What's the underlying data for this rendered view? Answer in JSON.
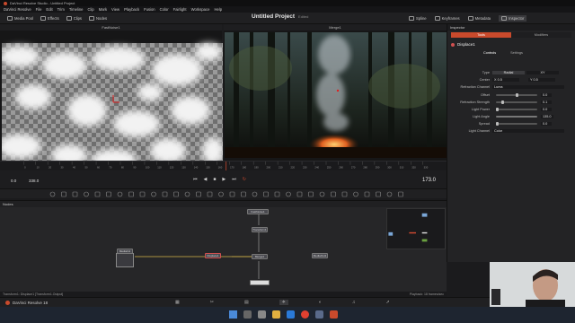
{
  "window": {
    "title": "DaVinci Resolve Studio - Untitled Project"
  },
  "menu": [
    "DaVinci Resolve",
    "File",
    "Edit",
    "Trim",
    "Timeline",
    "Clip",
    "Mark",
    "View",
    "Playback",
    "Fusion",
    "Color",
    "Fairlight",
    "Workspace",
    "Help"
  ],
  "toolbar": {
    "left": [
      "Media Pool",
      "Effects",
      "Clips",
      "Nodes"
    ],
    "project": "Untitled Project",
    "edited": "Edited",
    "right": [
      "Spline",
      "Keyframes",
      "Metadata",
      "Inspector"
    ]
  },
  "viewers": {
    "left_title": "FastNoise1",
    "right_title": "Merge1"
  },
  "ruler": [
    "0",
    "10",
    "20",
    "30",
    "40",
    "50",
    "60",
    "70",
    "80",
    "90",
    "100",
    "110",
    "120",
    "130",
    "140",
    "150",
    "160",
    "170",
    "180",
    "190",
    "200",
    "210",
    "220",
    "230",
    "240",
    "250",
    "260",
    "270",
    "280",
    "290",
    "300",
    "310",
    "320",
    "330"
  ],
  "transport": {
    "start": "0.0",
    "end": "338.0",
    "current": "173.0"
  },
  "nodes": {
    "panel_label": "Nodes",
    "items": [
      {
        "label": "MediaIn1",
        "color": "#6a6a70"
      },
      {
        "label": "Displace1",
        "color": "#7a5a5a"
      },
      {
        "label": "Merge1",
        "color": "#5a5a66"
      },
      {
        "label": "Transform1",
        "color": "#6a6a55"
      },
      {
        "label": "FastNoise1",
        "color": "#555a66"
      },
      {
        "label": "MediaOut1",
        "color": "#5a5a60"
      }
    ]
  },
  "status": {
    "left": "Transform1: Displace1 [Transform1.Output]",
    "right": "Playback: 18 frames/sec"
  },
  "pagebar": {
    "app": "DaVinci Resolve 18"
  },
  "inspector": {
    "title": "Inspector",
    "tabs": [
      "Tools",
      "Modifiers"
    ],
    "node": "Displace1",
    "subtabs": [
      "Controls",
      "Settings"
    ],
    "rows": [
      {
        "label": "Type",
        "value": "Radial",
        "value2": "XY"
      },
      {
        "label": "Center",
        "value": "X 0.5",
        "value2": "Y 0.5"
      },
      {
        "label": "Refraction Channel",
        "value": "Luma"
      },
      {
        "label": "Offset",
        "value": "0.0"
      },
      {
        "label": "Refraction Strength",
        "value": "0.1"
      },
      {
        "label": "Light Power",
        "value": "0.0"
      },
      {
        "label": "Light Angle",
        "value": "135.0"
      },
      {
        "label": "Spread",
        "value": "0.0"
      },
      {
        "label": "Light Channel",
        "value": "Color"
      }
    ]
  },
  "colors": {
    "accent": "#c94a2c",
    "link": "#d8b84a",
    "bg": "#1b1b1d"
  }
}
